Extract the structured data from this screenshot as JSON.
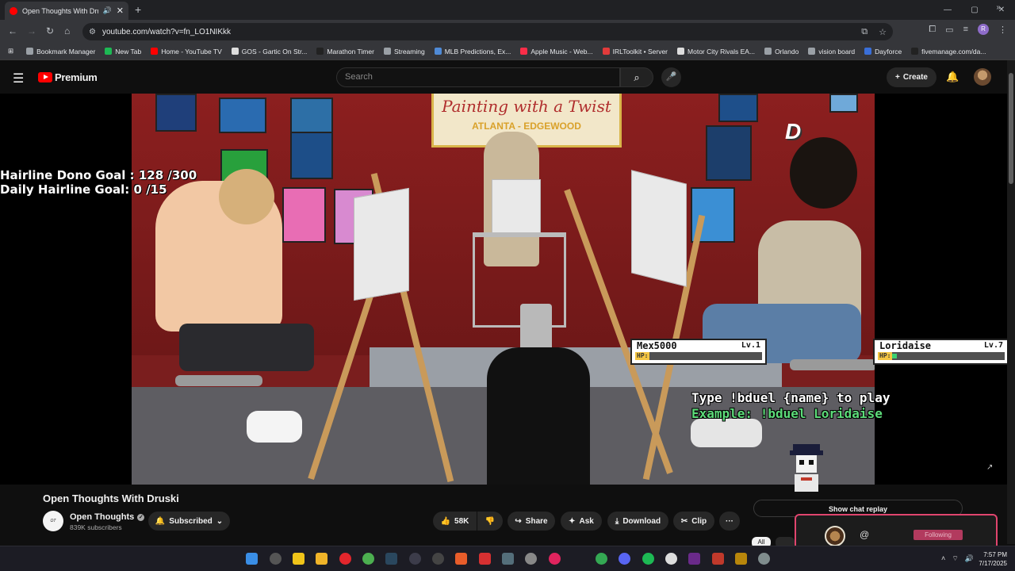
{
  "browser": {
    "tab_title": "Open Thoughts With Druski",
    "new_tab_symbol": "+",
    "url": "youtube.com/watch?v=fn_LO1NIKkk",
    "profile_letter": "R",
    "window_controls": [
      "—",
      "▢",
      "✕"
    ],
    "bookmarks": [
      {
        "label": "Bookmark Manager",
        "color": "#9aa0a6"
      },
      {
        "label": "New Tab",
        "color": "#1db954"
      },
      {
        "label": "Home - YouTube TV",
        "color": "#ff0000"
      },
      {
        "label": "GOS - Gartic On Str...",
        "color": "#dddddd"
      },
      {
        "label": "Marathon Timer",
        "color": "#222222"
      },
      {
        "label": "Streaming",
        "color": "#9aa0a6"
      },
      {
        "label": "MLB Predictions, Ex...",
        "color": "#4f8ad6"
      },
      {
        "label": "Apple Music - Web...",
        "color": "#fa2d48"
      },
      {
        "label": "IRLToolkit • Server",
        "color": "#e23b3b"
      },
      {
        "label": "Motor City Rivals EA...",
        "color": "#dddddd"
      },
      {
        "label": "Orlando",
        "color": "#9aa0a6"
      },
      {
        "label": "vision board",
        "color": "#9aa0a6"
      },
      {
        "label": "Dayforce",
        "color": "#3a6fd8"
      },
      {
        "label": "fivemanage.com/da...",
        "color": "#222222"
      }
    ],
    "bookmarks_more": "»"
  },
  "youtube": {
    "logo_text": "Premium",
    "search_placeholder": "Search",
    "create_label": "Create",
    "video_title": "Open Thoughts With Druski",
    "channel_name": "Open Thoughts",
    "subscribers": "839K subscribers",
    "subscribed_label": "Subscribed",
    "likes": "58K",
    "share_label": "Share",
    "ask_label": "Ask",
    "download_label": "Download",
    "clip_label": "Clip",
    "more_label": "···",
    "show_chat_replay": "Show chat replay",
    "chip_all": "All"
  },
  "overlay": {
    "dono_goal": "Hairline Dono Goal : 128 /300",
    "daily_goal": "Daily Hairline Goal: 0  /15",
    "banner_line1": "Painting with a Twist",
    "banner_line2": "ATLANTA - EDGEWOOD",
    "players": [
      {
        "name": "Mex5000",
        "level": "Lv.1",
        "hp_fraction": 0.0
      },
      {
        "name": "Loridaise",
        "level": "Lv.7",
        "hp_fraction": 0.04
      }
    ],
    "hp_label": "HP:",
    "instruction": "Type !bduel {name} to play",
    "example": "Example: !bduel Loridaise",
    "brand_logo": "D"
  },
  "popup": {
    "at_symbol": "@",
    "following_label": "Following"
  },
  "taskbar": {
    "date": "7/17/2025",
    "time": "7:57 PM"
  }
}
